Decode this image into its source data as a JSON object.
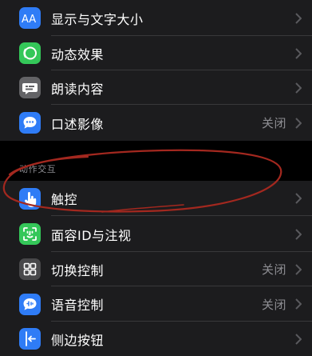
{
  "group1": {
    "items": [
      {
        "label": "显示与文字大小",
        "value": "",
        "icon": "text-size-icon",
        "color": "#2f7cf6"
      },
      {
        "label": "动态效果",
        "value": "",
        "icon": "motion-icon",
        "color": "#34c759"
      },
      {
        "label": "朗读内容",
        "value": "",
        "icon": "speech-bubble-icon",
        "color": "#636366"
      },
      {
        "label": "口述影像",
        "value": "关闭",
        "icon": "audio-description-icon",
        "color": "#2f7cf6"
      }
    ]
  },
  "section": {
    "header": "动作交互"
  },
  "group2": {
    "items": [
      {
        "label": "触控",
        "value": "",
        "icon": "hand-touch-icon",
        "color": "#2f7cf6"
      },
      {
        "label": "面容ID与注视",
        "value": "",
        "icon": "face-id-icon",
        "color": "#34c759"
      },
      {
        "label": "切换控制",
        "value": "关闭",
        "icon": "switch-control-icon",
        "color": "#48484a"
      },
      {
        "label": "语音控制",
        "value": "关闭",
        "icon": "voice-control-icon",
        "color": "#2f7cf6"
      },
      {
        "label": "侧边按钮",
        "value": "",
        "icon": "side-button-icon",
        "color": "#2f7cf6"
      }
    ]
  }
}
